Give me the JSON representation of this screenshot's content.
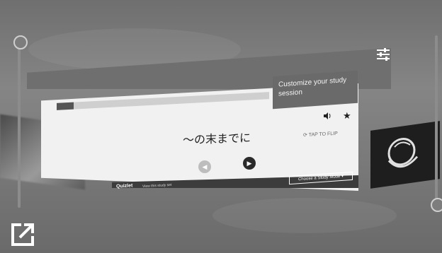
{
  "tooltip": {
    "text": "Customize your study session"
  },
  "card": {
    "term": "〜の末までに",
    "flip_label": "TAP TO FLIP"
  },
  "footer": {
    "brand": "Quizlet",
    "view_link": "View this study set",
    "study_mode_label": "Choose a Study Mode ▾"
  },
  "progress": {
    "fraction": 0.08
  },
  "icons": {
    "settings": "sliders-icon",
    "audio": "speaker-icon",
    "star": "star-icon",
    "prev": "arrow-left-icon",
    "next": "arrow-right-icon",
    "external": "external-link-icon"
  },
  "colors": {
    "panel_header": "#6f6f6f",
    "card_bg": "#f1f1f1",
    "footer_bg": "#3c3c3c"
  }
}
